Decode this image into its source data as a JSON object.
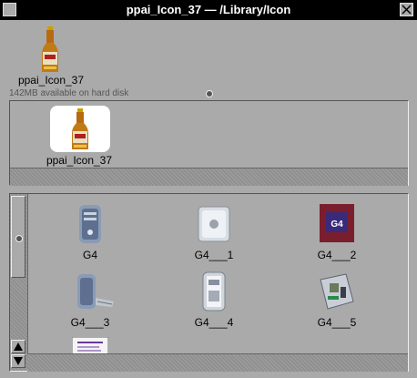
{
  "window": {
    "title": "ppai_Icon_37  —  /Library/Icon"
  },
  "path_icon": {
    "label": "ppai_Icon_37",
    "icon": "beer-bottle-icon"
  },
  "status": {
    "disk": "142MB available on hard disk"
  },
  "shelf": {
    "items": [
      {
        "label": "ppai_Icon_37",
        "icon": "beer-bottle-icon"
      }
    ]
  },
  "browser": {
    "items": [
      {
        "label": "G4",
        "icon": "power-mac-g4-tower-icon"
      },
      {
        "label": "G4___1",
        "icon": "power-mac-g4-cube-icon"
      },
      {
        "label": "G4___2",
        "icon": "g4-processor-chip-icon"
      },
      {
        "label": "G4___3",
        "icon": "power-mac-g4-tower-open-icon"
      },
      {
        "label": "G4___4",
        "icon": "power-mac-g4-tower-side-icon"
      },
      {
        "label": "G4___5",
        "icon": "g4-motherboard-icon"
      }
    ],
    "partial_item_icon": "document-icon"
  },
  "colors": {
    "background": "#aaaaaa",
    "titlebar": "#000000",
    "title_text": "#ffffff",
    "chip": "#7a1e2e"
  }
}
